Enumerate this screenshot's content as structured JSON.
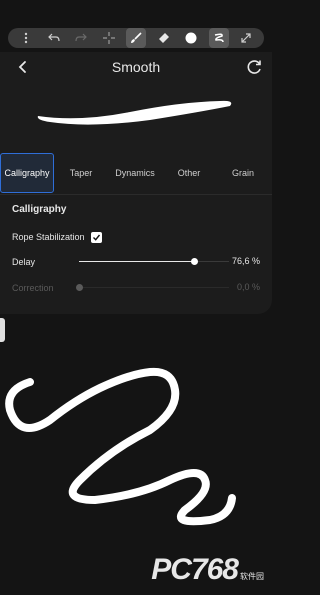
{
  "toolbar": {
    "icons": [
      "more-vertical",
      "undo",
      "redo",
      "move",
      "brush",
      "eraser",
      "color",
      "stroke-preview",
      "expand"
    ]
  },
  "panel": {
    "title": "Smooth",
    "tabs": [
      {
        "label": "Calligraphy",
        "selected": true
      },
      {
        "label": "Taper",
        "selected": false
      },
      {
        "label": "Dynamics",
        "selected": false
      },
      {
        "label": "Other",
        "selected": false
      },
      {
        "label": "Grain",
        "selected": false
      }
    ],
    "section_title": "Calligraphy",
    "rope_stabilization": {
      "label": "Rope Stabilization",
      "checked": true
    },
    "delay": {
      "label": "Delay",
      "value_text": "76,6 %",
      "fraction": 0.766
    },
    "correction": {
      "label": "Correction",
      "value_text": "0,0 %",
      "fraction": 0.0
    }
  },
  "watermark": {
    "text": "PC768",
    "sub": "软件园"
  },
  "colors": {
    "accent": "#2f6ed8",
    "background": "#141414",
    "panel": "#1c1c1c"
  }
}
